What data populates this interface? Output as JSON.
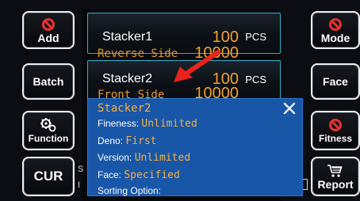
{
  "left_buttons": [
    {
      "label": "Add",
      "icon": "ban-icon"
    },
    {
      "label": "Batch",
      "icon": ""
    },
    {
      "label": "Function",
      "icon": "gears-icon"
    },
    {
      "label": "CUR",
      "icon": ""
    }
  ],
  "right_buttons": [
    {
      "label": "Mode",
      "icon": "ban-icon"
    },
    {
      "label": "Face",
      "icon": ""
    },
    {
      "label": "Fitness",
      "icon": "ban-icon"
    },
    {
      "label": "Report",
      "icon": "cart-icon"
    }
  ],
  "stackers": [
    {
      "title": "Stacker1",
      "side": "Reverse Side",
      "count": "100",
      "unit": "PCS",
      "total": "10000"
    },
    {
      "title": "Stacker2",
      "side": "Front Side",
      "count": "100",
      "unit": "PCS",
      "total": "10000"
    }
  ],
  "popup": {
    "title": "Stacker2",
    "rows": [
      {
        "label": "Fineness:",
        "value": "Unlimited"
      },
      {
        "label": "Deno:",
        "value": "First"
      },
      {
        "label": "Version:",
        "value": "Unlimited"
      },
      {
        "label": "Face:",
        "value": "Specified"
      },
      {
        "label": "Sorting Option:",
        "value": ""
      }
    ]
  },
  "colors": {
    "accent_orange": "#f0a32a",
    "panel_border": "#2fb0c8",
    "popup_bg": "#1856a8",
    "arrow_red": "#e8231b"
  }
}
